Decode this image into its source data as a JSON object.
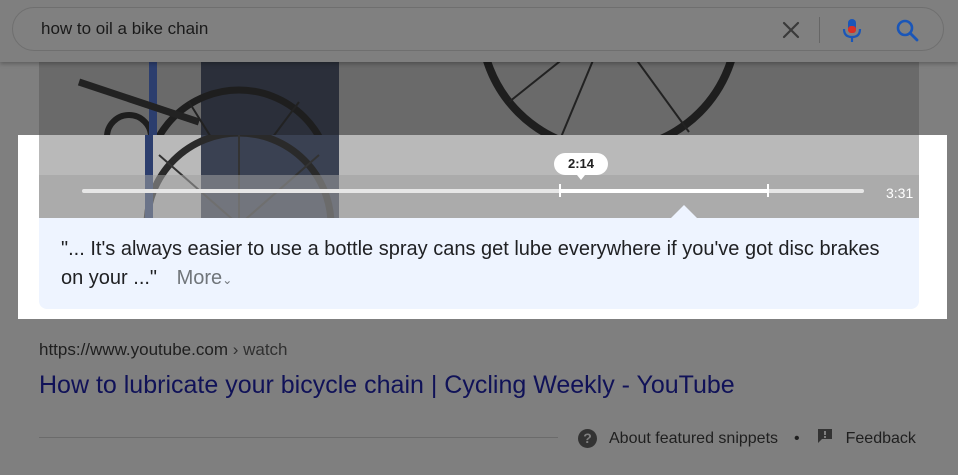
{
  "search": {
    "query": "how to oil a bike chain"
  },
  "video": {
    "hover_time": "2:14",
    "duration": "3:31"
  },
  "snippet": {
    "quote": "\"... It's always easier to use a bottle spray cans get lube everywhere if you've got disc brakes on your ...\"",
    "more_label": "More",
    "more_chevron": "⌄"
  },
  "result": {
    "url_base": "https://www.youtube.com",
    "url_path": " › watch",
    "title": "How to lubricate your bicycle chain | Cycling Weekly - YouTube"
  },
  "footer": {
    "about_label": "About featured snippets",
    "separator": "•",
    "feedback_label": "Feedback"
  },
  "colors": {
    "mic_red": "#d93025",
    "mic_blue": "#1a56b8",
    "search_blue": "#1a56b8",
    "quote_bg": "#eef4ff",
    "link_title": "#101258"
  }
}
